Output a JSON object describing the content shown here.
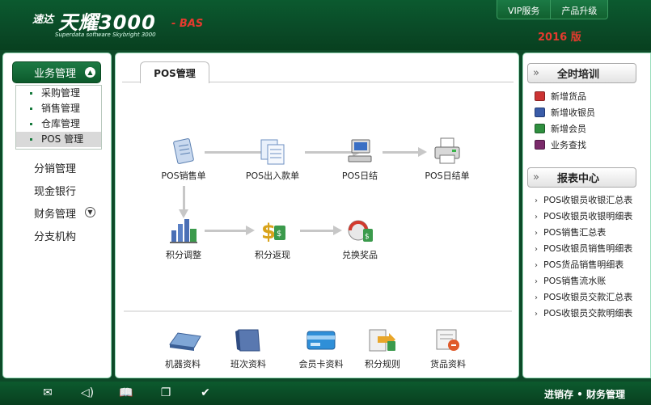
{
  "header": {
    "logo_prefix": "速达",
    "logo_main": "天耀3000",
    "logo_suffix": "- BAS",
    "logo_subtitle": "Superdata software Skybright 3000",
    "links": [
      "VIP服务",
      "产品升级"
    ],
    "version": "2016 版"
  },
  "sidebar": {
    "header_label": "业务管理",
    "submenu": [
      "采购管理",
      "销售管理",
      "仓库管理",
      "POS 管理"
    ],
    "items": [
      "分销管理",
      "现金银行",
      "财务管理",
      "分支机构"
    ]
  },
  "main": {
    "tab": "POS管理",
    "flow": {
      "pos_sales": "POS销售单",
      "pos_inout": "POS出入款单",
      "pos_daily": "POS日结",
      "pos_daily_report": "POS日结单",
      "points_adjust": "积分调整",
      "points_cashback": "积分返现",
      "redeem_prize": "兑换奖品"
    },
    "bottom": [
      "机器资料",
      "班次资料",
      "会员卡资料",
      "积分规则",
      "货品资料"
    ]
  },
  "right": {
    "training_title": "全时培训",
    "training_links": [
      "新增货品",
      "新增收银员",
      "新增会员",
      "业务查找"
    ],
    "report_title": "报表中心",
    "reports": [
      "POS收银员收银汇总表",
      "POS收银员收银明细表",
      "POS销售汇总表",
      "POS收银员销售明细表",
      "POS货品销售明细表",
      "POS销售流水账",
      "POS收银员交款汇总表",
      "POS收银员交款明细表"
    ]
  },
  "statusbar": {
    "icons": [
      "mail-icon",
      "speaker-icon",
      "book-icon",
      "copy-icon",
      "check-icon"
    ],
    "text": "进销存 • 财务管理"
  },
  "colors": {
    "brand_green": "#0b5a2f",
    "accent_red": "#e53a2e"
  }
}
